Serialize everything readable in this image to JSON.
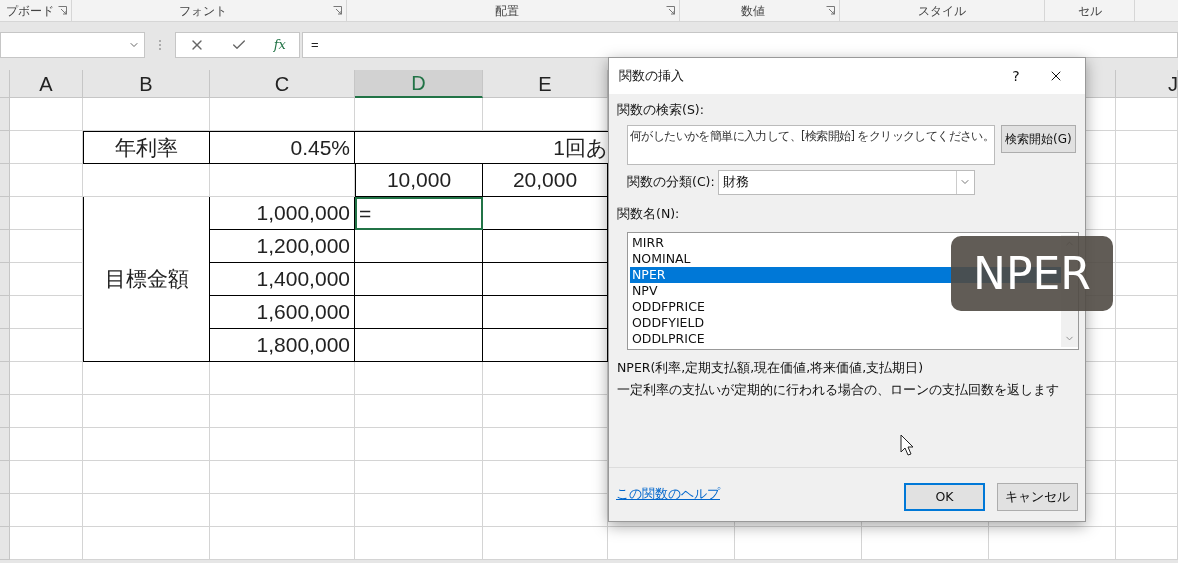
{
  "ribbon": {
    "groups": [
      {
        "label": "プボード",
        "launcher": true
      },
      {
        "label": "フォント",
        "launcher": true
      },
      {
        "label": "配置",
        "launcher": true
      },
      {
        "label": "数値",
        "launcher": true
      },
      {
        "label": "スタイル",
        "launcher": false
      },
      {
        "label": "セル",
        "launcher": false
      }
    ]
  },
  "formula_bar": {
    "function_button": "fx",
    "formula": "="
  },
  "sheet": {
    "columns": [
      {
        "label": "A",
        "selected": false
      },
      {
        "label": "B",
        "selected": false
      },
      {
        "label": "C",
        "selected": false
      },
      {
        "label": "D",
        "selected": true
      },
      {
        "label": "E",
        "selected": false
      },
      {
        "label": "J",
        "selected": false
      }
    ],
    "rate_label": "年利率",
    "rate_value": "0.45%",
    "payment_header": "1回あ",
    "payments": [
      "10,000",
      "20,000"
    ],
    "target_label": "目標金額",
    "targets": [
      "1,000,000",
      "1,200,000",
      "1,400,000",
      "1,600,000",
      "1,800,000"
    ],
    "active_cell_value": "="
  },
  "dialog": {
    "title": "関数の挿入",
    "help_button": "?",
    "search_label": "関数の検索(S):",
    "search_placeholder": "何がしたいかを簡単に入力して、[検索開始] をクリックしてください。",
    "search_button": "検索開始(G)",
    "category_label": "関数の分類(C):",
    "category_value": "財務",
    "functions_label": "関数名(N):",
    "functions": [
      {
        "name": "MIRR",
        "selected": false
      },
      {
        "name": "NOMINAL",
        "selected": false
      },
      {
        "name": "NPER",
        "selected": true
      },
      {
        "name": "NPV",
        "selected": false
      },
      {
        "name": "ODDFPRICE",
        "selected": false
      },
      {
        "name": "ODDFYIELD",
        "selected": false
      },
      {
        "name": "ODDLPRICE",
        "selected": false
      }
    ],
    "syntax": "NPER(利率,定期支払額,現在価値,将来価値,支払期日)",
    "description": "一定利率の支払いが定期的に行われる場合の、ローンの支払回数を返します",
    "help_link": "この関数のヘルプ",
    "ok_button": "OK",
    "cancel_button": "キャンセル"
  },
  "caption": "NPER"
}
